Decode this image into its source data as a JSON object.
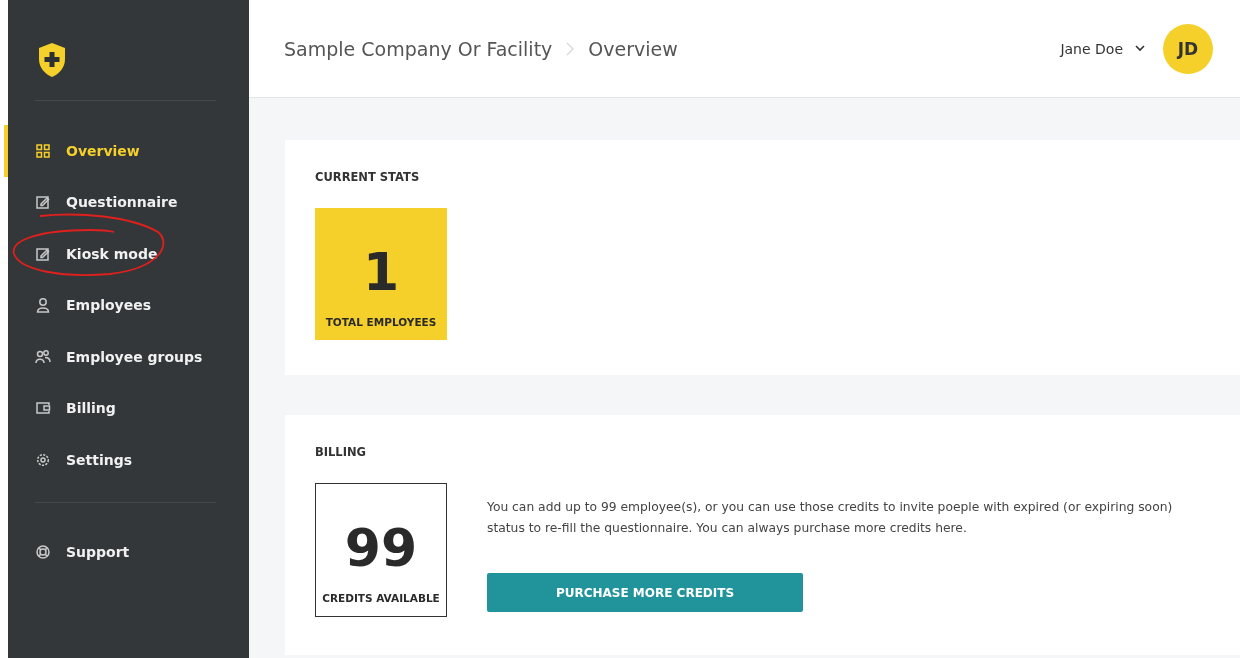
{
  "sidebar": {
    "items": [
      {
        "label": "Overview",
        "kind": "grid",
        "selected": true
      },
      {
        "label": "Questionnaire",
        "kind": "edit",
        "selected": false
      },
      {
        "label": "Kiosk mode",
        "kind": "edit",
        "selected": false
      },
      {
        "label": "Employees",
        "kind": "person",
        "selected": false
      },
      {
        "label": "Employee groups",
        "kind": "people",
        "selected": false
      },
      {
        "label": "Billing",
        "kind": "wallet",
        "selected": false
      },
      {
        "label": "Settings",
        "kind": "gear",
        "selected": false
      }
    ],
    "footer_items": [
      {
        "label": "Support",
        "kind": "lifebuoy",
        "selected": false
      }
    ]
  },
  "header": {
    "breadcrumbs": [
      "Sample Company Or Facility",
      "Overview"
    ],
    "user_name": "Jane Doe",
    "avatar_initials": "JD"
  },
  "stats": {
    "title": "CURRENT STATS",
    "tiles": [
      {
        "value": "1",
        "label": "TOTAL EMPLOYEES"
      }
    ]
  },
  "billing": {
    "title": "BILLING",
    "credits": {
      "value": "99",
      "label": "CREDITS AVAILABLE"
    },
    "text": "You can add up to 99 employee(s), or you can use those credits to invite poeple with expired (or expiring soon) status to re-fill the questionnaire. You can always purchase more credits here.",
    "button": "PURCHASE MORE CREDITS"
  }
}
